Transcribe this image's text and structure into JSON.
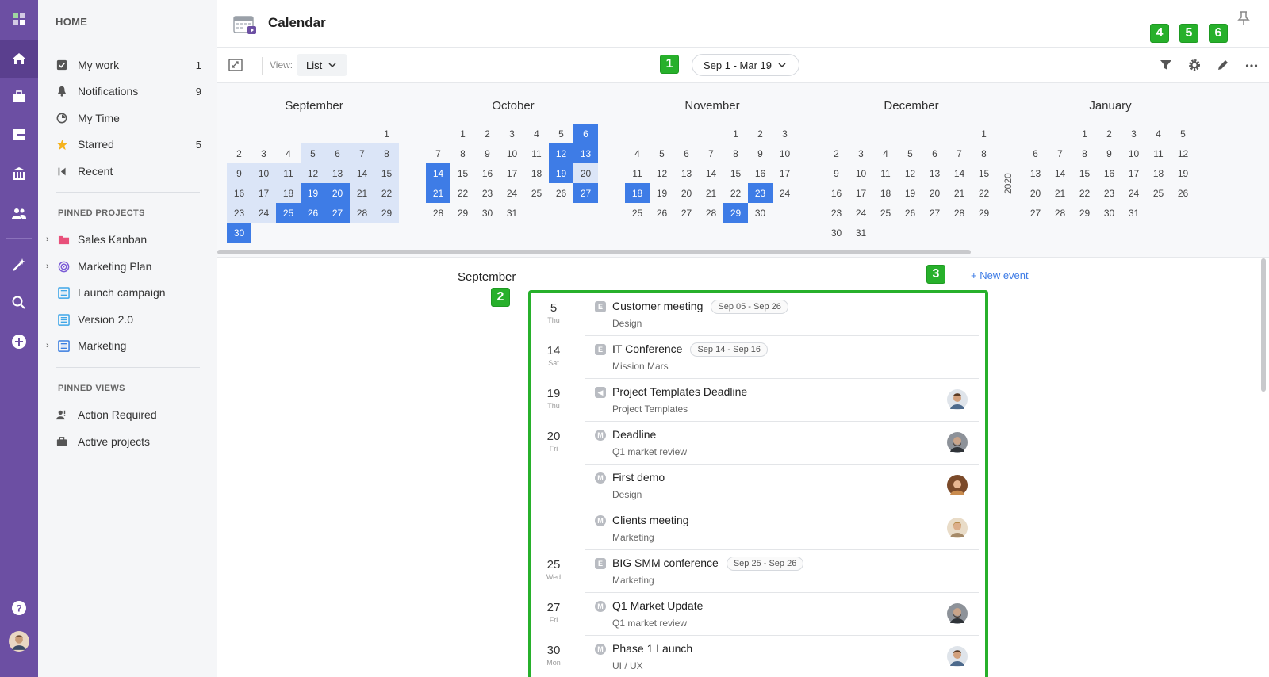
{
  "header": {
    "title": "Calendar"
  },
  "toolbar": {
    "view_label": "View:",
    "view_value": "List",
    "range": "Sep 1 - Mar 19"
  },
  "badges": [
    "1",
    "2",
    "3",
    "4",
    "5",
    "6"
  ],
  "sidebar": {
    "home": "HOME",
    "items": [
      {
        "label": "My work",
        "count": "1"
      },
      {
        "label": "Notifications",
        "count": "9"
      },
      {
        "label": "My Time",
        "count": ""
      },
      {
        "label": "Starred",
        "count": "5"
      },
      {
        "label": "Recent",
        "count": ""
      }
    ],
    "pinned_projects_title": "PINNED PROJECTS",
    "projects": [
      {
        "label": "Sales Kanban"
      },
      {
        "label": "Marketing Plan"
      },
      {
        "label": "Launch campaign"
      },
      {
        "label": "Version 2.0"
      },
      {
        "label": "Marketing"
      }
    ],
    "pinned_views_title": "PINNED VIEWS",
    "views": [
      {
        "label": "Action Required"
      },
      {
        "label": "Active projects"
      }
    ]
  },
  "mini": {
    "year": "2020",
    "months": [
      {
        "name": "September",
        "offset": 6,
        "days": 30,
        "light": [
          5,
          6,
          7,
          8,
          9,
          10,
          11,
          12,
          13,
          14,
          15,
          16,
          17,
          18,
          21,
          22,
          23,
          24,
          28,
          29,
          30
        ],
        "hl": [
          19,
          20,
          25,
          26,
          27,
          30
        ]
      },
      {
        "name": "October",
        "offset": 1,
        "days": 31,
        "light": [
          20
        ],
        "hl": [
          6,
          12,
          13,
          14,
          19,
          21,
          27
        ]
      },
      {
        "name": "November",
        "offset": 4,
        "days": 30,
        "light": [],
        "hl": [
          18,
          23,
          29
        ]
      },
      {
        "name": "December",
        "offset": 6,
        "days": 31,
        "light": [],
        "hl": []
      },
      {
        "name": "January",
        "offset": 2,
        "days": 31,
        "light": [],
        "hl": []
      }
    ]
  },
  "list": {
    "month_title": "September",
    "new_event": "+ New event",
    "events": [
      {
        "dnum": "5",
        "dday": "Thu",
        "type": "E",
        "title": "Customer meeting",
        "range": "Sep 05 - Sep 26",
        "sub": "Design",
        "avatar": ""
      },
      {
        "dnum": "14",
        "dday": "Sat",
        "type": "E",
        "title": "IT Conference",
        "range": "Sep 14 - Sep 16",
        "sub": "Mission Mars",
        "avatar": ""
      },
      {
        "dnum": "19",
        "dday": "Thu",
        "type": "D",
        "title": "Project Templates Deadline",
        "range": "",
        "sub": "Project Templates",
        "avatar": "a1"
      },
      {
        "dnum": "20",
        "dday": "Fri",
        "type": "M",
        "title": "Deadline",
        "range": "",
        "sub": "Q1 market review",
        "avatar": "a2"
      },
      {
        "dnum": "",
        "dday": "",
        "type": "M",
        "title": "First demo",
        "range": "",
        "sub": "Design",
        "avatar": "a3"
      },
      {
        "dnum": "",
        "dday": "",
        "type": "M",
        "title": "Clients meeting",
        "range": "",
        "sub": "Marketing",
        "avatar": "a4"
      },
      {
        "dnum": "25",
        "dday": "Wed",
        "type": "E",
        "title": "BIG SMM conference",
        "range": "Sep 25 - Sep 26",
        "sub": "Marketing",
        "avatar": ""
      },
      {
        "dnum": "27",
        "dday": "Fri",
        "type": "M",
        "title": "Q1 Market Update",
        "range": "",
        "sub": "Q1 market review",
        "avatar": "a2"
      },
      {
        "dnum": "30",
        "dday": "Mon",
        "type": "M",
        "title": "Phase 1 Launch",
        "range": "",
        "sub": "UI / UX",
        "avatar": "a1"
      }
    ]
  },
  "colors": {
    "rail": "#6c4fa3",
    "accent": "#3e7ce6",
    "highlight_green": "#27b02b"
  }
}
